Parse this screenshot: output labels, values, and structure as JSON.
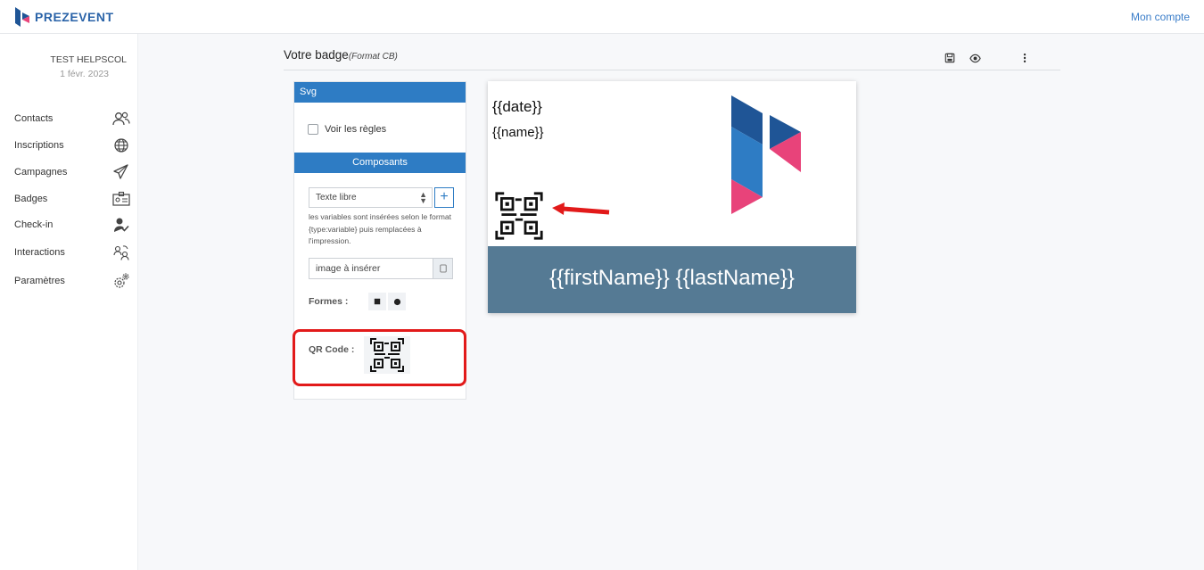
{
  "app": {
    "brand": "PREZEVENT",
    "account_link": "Mon compte"
  },
  "sidebar": {
    "org_name": "TEST HELPSCOL",
    "org_date": "1 févr. 2023",
    "items": [
      {
        "label": "Contacts",
        "icon": "contacts-icon"
      },
      {
        "label": "Inscriptions",
        "icon": "globe-icon"
      },
      {
        "label": "Campagnes",
        "icon": "paper-plane-icon"
      },
      {
        "label": "Badges",
        "icon": "id-card-icon"
      },
      {
        "label": "Check-in",
        "icon": "user-check-icon"
      },
      {
        "label": "Interactions",
        "icon": "interactions-icon"
      },
      {
        "label": "Paramètres",
        "icon": "gears-icon"
      }
    ]
  },
  "header": {
    "title": "Votre badge",
    "format": "(Format CB)",
    "actions": [
      "save-icon",
      "eye-icon",
      "more-vertical-icon"
    ]
  },
  "panel": {
    "svg_heading": "Svg",
    "rules_label": "Voir les règles",
    "components_heading": "Composants",
    "select_value": "Texte libre",
    "add_label": "+",
    "help_text": "les variables sont insérées selon le format {type:variable} puis remplacées à l'impression.",
    "image_placeholder": "image à insérer",
    "shapes_label": "Formes :",
    "qr_label": "QR Code :"
  },
  "badge": {
    "date_var": "{{date}}",
    "name_var": "{{name}}",
    "fullname_var": "{{firstName}} {{lastName}}",
    "footer_color": "#557a94"
  },
  "colors": {
    "accent": "#2e7cc4",
    "highlight": "#e21a1a",
    "logo_dark_blue": "#1f5596",
    "logo_blue": "#2e7cc4",
    "logo_pink": "#e8437a"
  }
}
